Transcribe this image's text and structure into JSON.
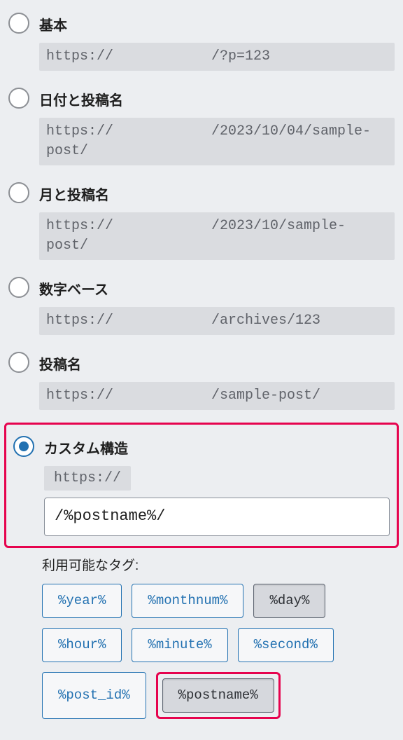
{
  "options": [
    {
      "label": "基本",
      "prefix": "https://",
      "sample": "/?p=123",
      "checked": false
    },
    {
      "label": "日付と投稿名",
      "prefix": "https://",
      "sample": "/2023/10/04/sample-post/",
      "checked": false
    },
    {
      "label": "月と投稿名",
      "prefix": "https://",
      "sample": "/2023/10/sample-post/",
      "checked": false
    },
    {
      "label": "数字ベース",
      "prefix": "https://",
      "sample": "/archives/123",
      "checked": false
    },
    {
      "label": "投稿名",
      "prefix": "https://",
      "sample": "/sample-post/",
      "checked": false
    }
  ],
  "custom": {
    "label": "カスタム構造",
    "prefix": "https://",
    "value": "/%postname%/",
    "checked": true
  },
  "tags": {
    "label": "利用可能なタグ:",
    "items": [
      {
        "text": "%year%",
        "pressed": false,
        "highlight": false
      },
      {
        "text": "%monthnum%",
        "pressed": false,
        "highlight": false
      },
      {
        "text": "%day%",
        "pressed": true,
        "highlight": false
      },
      {
        "text": "%hour%",
        "pressed": false,
        "highlight": false
      },
      {
        "text": "%minute%",
        "pressed": false,
        "highlight": false
      },
      {
        "text": "%second%",
        "pressed": false,
        "highlight": false
      },
      {
        "text": "%post_id%",
        "pressed": false,
        "highlight": false
      },
      {
        "text": "%postname%",
        "pressed": true,
        "highlight": true
      }
    ]
  }
}
